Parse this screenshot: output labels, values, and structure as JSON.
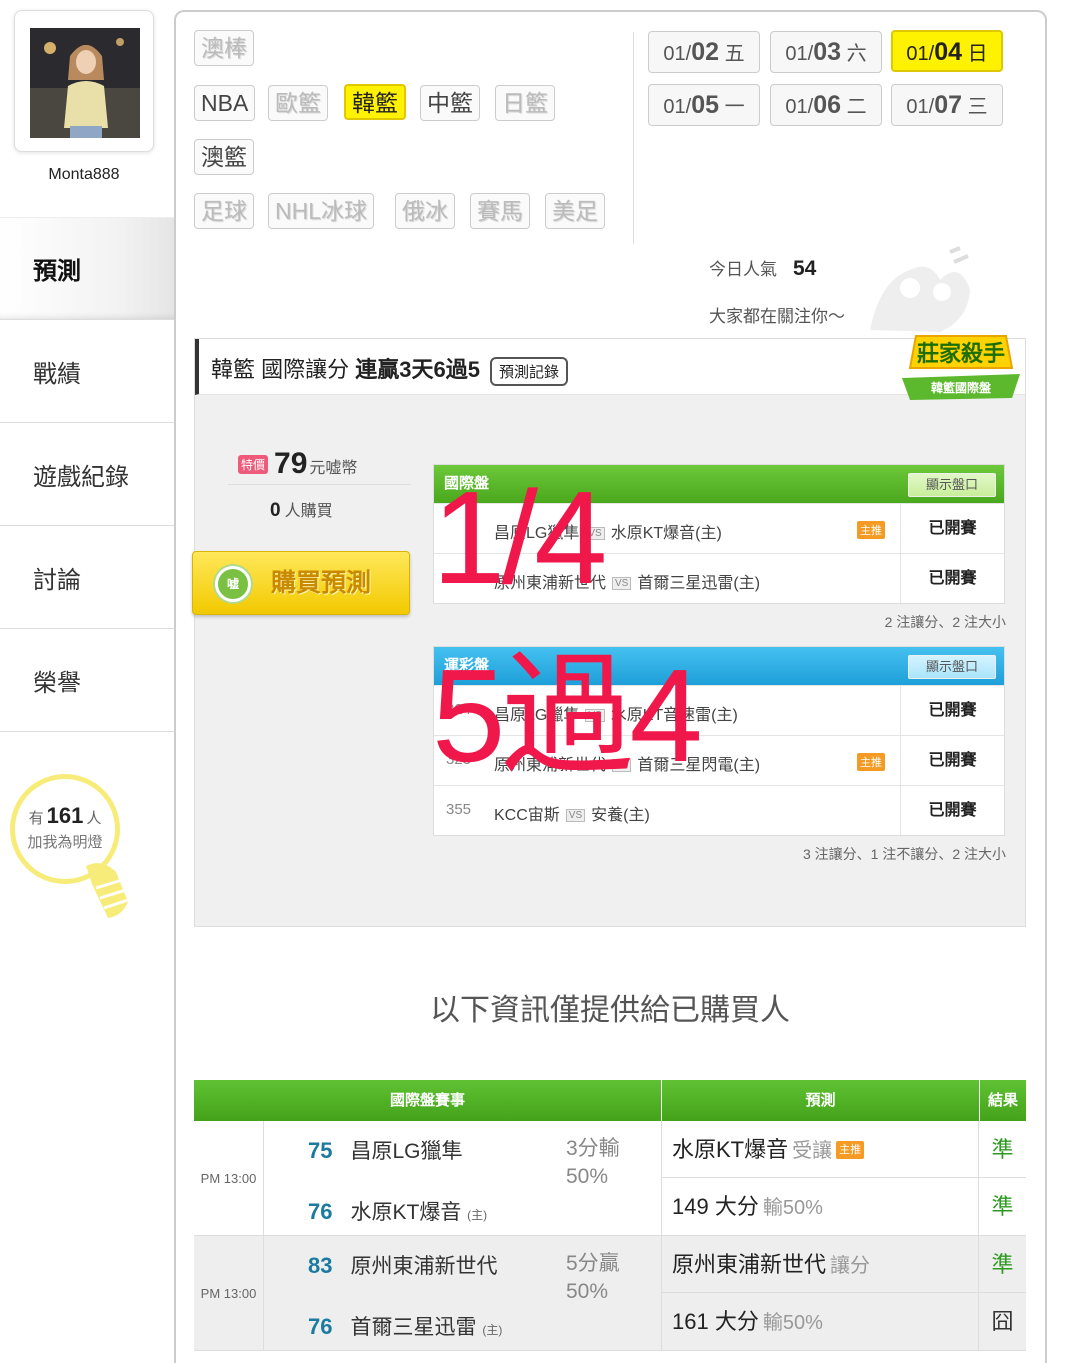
{
  "user": {
    "name": "Monta888"
  },
  "side_nav": [
    "預測",
    "戰績",
    "遊戲紀錄",
    "討論",
    "榮譽"
  ],
  "bulb": {
    "prefix": "有",
    "count": "161",
    "suffix": "人",
    "line2": "加我為明燈"
  },
  "sports": {
    "row1": [
      "澳棒"
    ],
    "row2": [
      "NBA",
      "歐籃",
      "韓籃",
      "中籃",
      "日籃"
    ],
    "row3": [
      "澳籃"
    ],
    "row4": [
      "足球",
      "NHL冰球",
      "俄冰",
      "賽馬",
      "美足"
    ],
    "selected": "韓籃"
  },
  "dates": [
    {
      "m": "01/",
      "d": "02",
      "w": "五"
    },
    {
      "m": "01/",
      "d": "03",
      "w": "六"
    },
    {
      "m": "01/",
      "d": "04",
      "w": "日"
    },
    {
      "m": "01/",
      "d": "05",
      "w": "一"
    },
    {
      "m": "01/",
      "d": "06",
      "w": "二"
    },
    {
      "m": "01/",
      "d": "07",
      "w": "三"
    }
  ],
  "selected_date": "01/04 日",
  "popularity": {
    "label": "今日人氣",
    "value": "54",
    "sub": "大家都在關注你～"
  },
  "prediction": {
    "title_pre": "韓籃 國際讓分 ",
    "title_bold": "連贏3天6過5",
    "record_btn": "預測記錄",
    "badge_line1": "莊家殺手",
    "badge_line2": "韓籃國際盤",
    "hot_tag": "特價",
    "price": "79",
    "price_unit": "元嘘幣",
    "buyers": "0",
    "buyers_unit": "人購買",
    "buy_btn": "購買預測",
    "buy_coin": "嘘"
  },
  "intl_table": {
    "title": "國際盤",
    "show_btn": "顯示盤口",
    "rows": [
      {
        "num": "",
        "home": "昌原LG獵隼",
        "away": "水原KT爆音(主)",
        "rec": "主推",
        "status": "已開賽"
      },
      {
        "num": "",
        "home": "原州東浦新世代",
        "away": "首爾三星迅雷(主)",
        "rec": "",
        "status": "已開賽"
      }
    ],
    "note": "2 注讓分、2 注大小"
  },
  "sport_table": {
    "title": "運彩盤",
    "show_btn": "顯示盤口",
    "rows": [
      {
        "num": "324",
        "home": "昌原LG獵隼",
        "away": "水原KT音速雷(主)",
        "rec": "",
        "status": "已開賽"
      },
      {
        "num": "323",
        "home": "原州東浦新世代",
        "away": "首爾三星閃電(主)",
        "rec": "主推",
        "status": "已開賽"
      },
      {
        "num": "355",
        "home": "KCC宙斯",
        "away": "安養(主)",
        "rec": "",
        "status": "已開賽"
      }
    ],
    "note": "3 注讓分、1 注不讓分、2 注大小"
  },
  "overlay": {
    "line1": "1/4",
    "line2": "5過4"
  },
  "info_text": "以下資訊僅提供給已購買人",
  "results": {
    "headers": [
      "國際盤賽事",
      "預測",
      "結果"
    ],
    "games": [
      {
        "time": "PM 13:00",
        "t1_score": "75",
        "t1": "昌原LG獵隼",
        "t1_tag": "",
        "t2_score": "76",
        "t2": "水原KT爆音",
        "t2_tag": "(主)",
        "outcome1": "3分輸",
        "outcome2": "50%",
        "p1_main": "水原KT爆音",
        "p1_type": "受讓",
        "p1_rec": "主推",
        "p2_main": "149 大分",
        "p2_type": "輸50%",
        "r1": "準",
        "r2": "準"
      },
      {
        "time": "PM 13:00",
        "t1_score": "83",
        "t1": "原州東浦新世代",
        "t1_tag": "",
        "t2_score": "76",
        "t2": "首爾三星迅雷",
        "t2_tag": "(主)",
        "outcome1": "5分贏",
        "outcome2": "50%",
        "p1_main": "原州東浦新世代",
        "p1_type": "讓分",
        "p1_rec": "",
        "p2_main": "161 大分",
        "p2_type": "輸50%",
        "r1": "準",
        "r2": "囧"
      }
    ]
  },
  "colors": {
    "accent_yellow": "#fff200",
    "green_head": "#4aa81d",
    "blue_head": "#1f9fd9",
    "overlay": "#f0184a"
  }
}
